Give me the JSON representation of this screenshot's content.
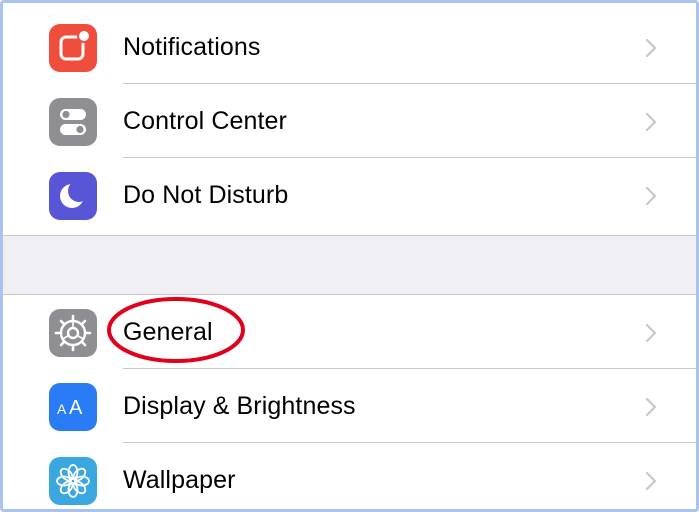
{
  "settings": {
    "group1": [
      {
        "label": "Notifications",
        "icon": "notifications-icon",
        "color": "#ef4e3c"
      },
      {
        "label": "Control Center",
        "icon": "control-center-icon",
        "color": "#8e8e93"
      },
      {
        "label": "Do Not Disturb",
        "icon": "moon-icon",
        "color": "#5856d6"
      }
    ],
    "group2": [
      {
        "label": "General",
        "icon": "gear-icon",
        "color": "#8e8e93"
      },
      {
        "label": "Display & Brightness",
        "icon": "text-size-icon",
        "color": "#2a7cf6",
        "glyph": "AA"
      },
      {
        "label": "Wallpaper",
        "icon": "flower-icon",
        "color": "#3aa7e0"
      }
    ]
  },
  "annotation": {
    "color": "#e2001a",
    "target": "General"
  }
}
